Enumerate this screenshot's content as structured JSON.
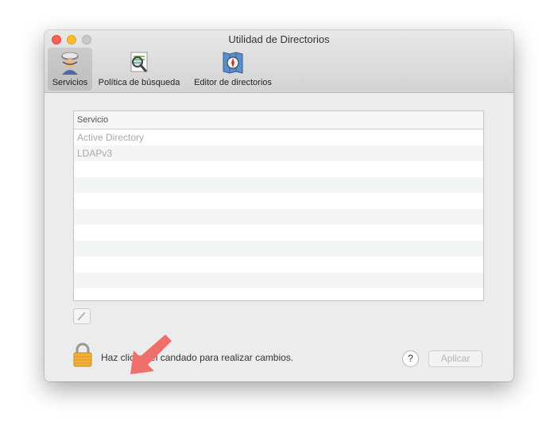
{
  "window": {
    "title": "Utilidad de Directorios"
  },
  "toolbar": {
    "items": [
      {
        "label": "Servicios",
        "icon": "services-icon",
        "selected": true
      },
      {
        "label": "Política de búsqueda",
        "icon": "search-policy-icon",
        "selected": false
      },
      {
        "label": "Editor de directorios",
        "icon": "directory-editor-icon",
        "selected": false
      }
    ]
  },
  "services_table": {
    "header": "Servicio",
    "rows": [
      "Active Directory",
      "LDAPv3"
    ]
  },
  "footer": {
    "lock_text": "Haz clic en el candado para realizar cambios.",
    "help_label": "?",
    "apply_label": "Aplicar"
  },
  "colors": {
    "close": "#fc5f57",
    "minimize": "#fdbc2e",
    "arrow": "#ef6f6c",
    "lock": "#f3b13a",
    "watermark": "#8cb8cf"
  }
}
